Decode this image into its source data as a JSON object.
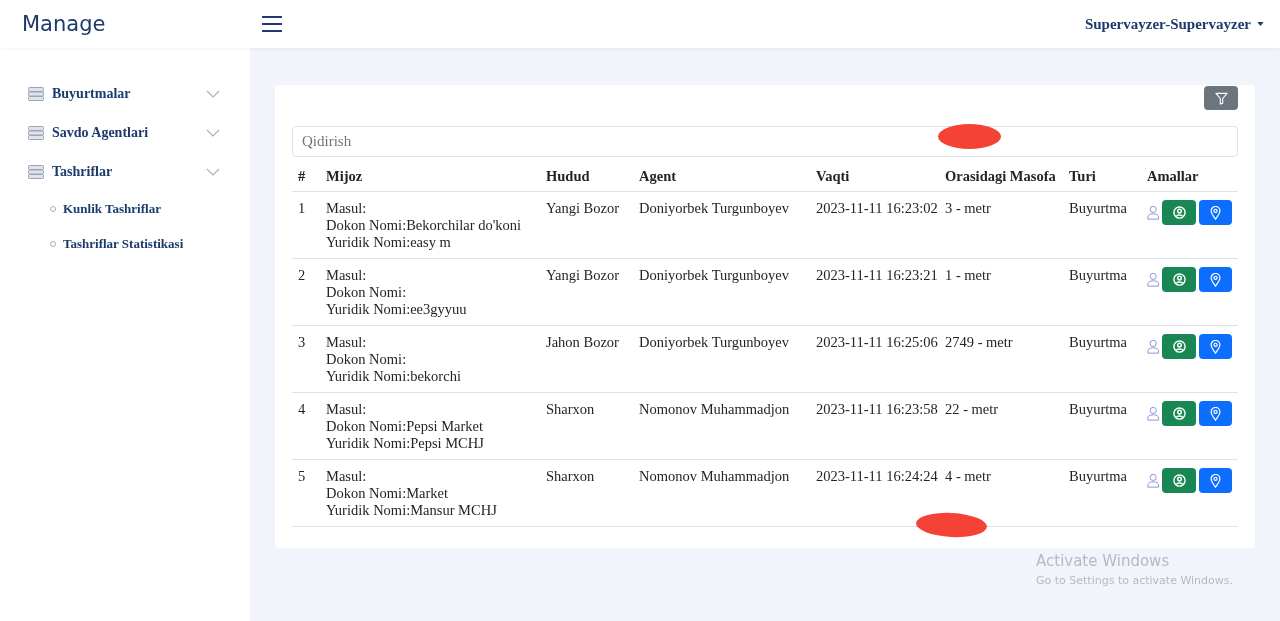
{
  "header": {
    "brand": "Manage",
    "user": "Supervayzer-Supervayzer"
  },
  "sidebar": {
    "items": [
      {
        "label": "Buyurtmalar"
      },
      {
        "label": "Savdo Agentlari"
      },
      {
        "label": "Tashriflar",
        "children": [
          {
            "label": "Kunlik Tashriflar"
          },
          {
            "label": "Tashriflar Statistikasi"
          }
        ]
      }
    ]
  },
  "search": {
    "placeholder": "Qidirish"
  },
  "table": {
    "columns": [
      "#",
      "Mijoz",
      "Hudud",
      "Agent",
      "Vaqti",
      "Orasidagi Masofa",
      "Turi",
      "Amallar"
    ],
    "rows": [
      {
        "number": "1",
        "client": [
          "Masul:",
          "Dokon Nomi:Bekorchilar do'koni",
          "Yuridik Nomi:easy m"
        ],
        "region": "Yangi Bozor",
        "agent": "Doniyorbek Turgunboyev",
        "time": "2023-11-11 16:23:02",
        "distance": "3 - metr",
        "type": "Buyurtma"
      },
      {
        "number": "2",
        "client": [
          "Masul:",
          "Dokon Nomi:",
          "Yuridik Nomi:ee3gyyuu"
        ],
        "region": "Yangi Bozor",
        "agent": "Doniyorbek Turgunboyev",
        "time": "2023-11-11 16:23:21",
        "distance": "1 - metr",
        "type": "Buyurtma"
      },
      {
        "number": "3",
        "client": [
          "Masul:",
          "Dokon Nomi:",
          "Yuridik Nomi:bekorchi"
        ],
        "region": "Jahon Bozor",
        "agent": "Doniyorbek Turgunboyev",
        "time": "2023-11-11 16:25:06",
        "distance": "2749 - metr",
        "type": "Buyurtma"
      },
      {
        "number": "4",
        "client": [
          "Masul:",
          "Dokon Nomi:Pepsi Market",
          "Yuridik Nomi:Pepsi MCHJ"
        ],
        "region": "Sharxon",
        "agent": "Nomonov Muhammadjon",
        "time": "2023-11-11 16:23:58",
        "distance": "22 - metr",
        "type": "Buyurtma"
      },
      {
        "number": "5",
        "client": [
          "Masul:",
          "Dokon Nomi:Market",
          "Yuridik Nomi:Mansur MCHJ"
        ],
        "region": "Sharxon",
        "agent": "Nomonov Muhammadjon",
        "time": "2023-11-11 16:24:24",
        "distance": "4 - metr",
        "type": "Buyurtma"
      }
    ]
  },
  "os_notice": {
    "title": "Activate Windows",
    "text": "Go to Settings to activate Windows."
  }
}
